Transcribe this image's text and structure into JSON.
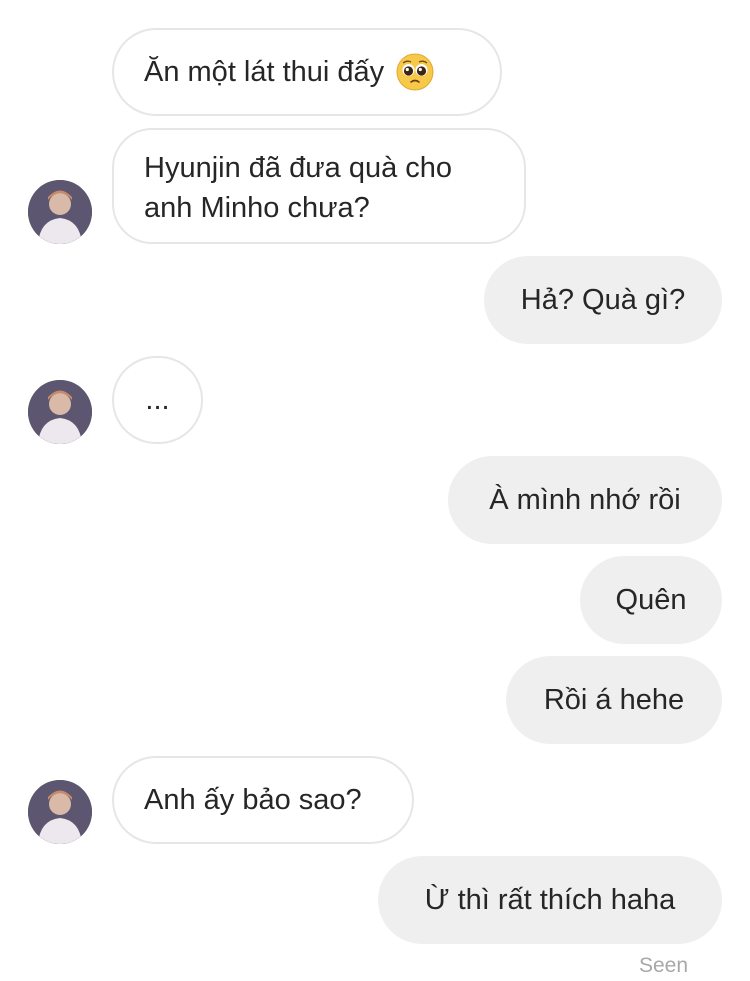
{
  "messages": [
    {
      "direction": "incoming",
      "text": "Ăn một lát thui đấy",
      "emoji": "pleading-face-emoji"
    },
    {
      "direction": "incoming",
      "lines": [
        "Hyunjin đã đưa quà cho",
        "anh Minho chưa?"
      ],
      "avatar": true
    },
    {
      "direction": "outgoing",
      "text": "Hả? Quà gì?"
    },
    {
      "direction": "incoming",
      "text": "...",
      "avatar": true
    },
    {
      "direction": "outgoing",
      "text": "À mình nhớ rồi"
    },
    {
      "direction": "outgoing",
      "text": "Quên"
    },
    {
      "direction": "outgoing",
      "text": "Rồi á hehe"
    },
    {
      "direction": "incoming",
      "text": "Anh ấy bảo sao?",
      "avatar": true
    },
    {
      "direction": "outgoing",
      "text": "Ừ thì rất thích haha"
    }
  ],
  "status": {
    "seen_label": "Seen"
  },
  "colors": {
    "incoming_bg": "#ffffff",
    "incoming_border": "#e6e6e6",
    "outgoing_bg": "#efefef",
    "text": "#262626",
    "seen": "#a8a8a8"
  }
}
